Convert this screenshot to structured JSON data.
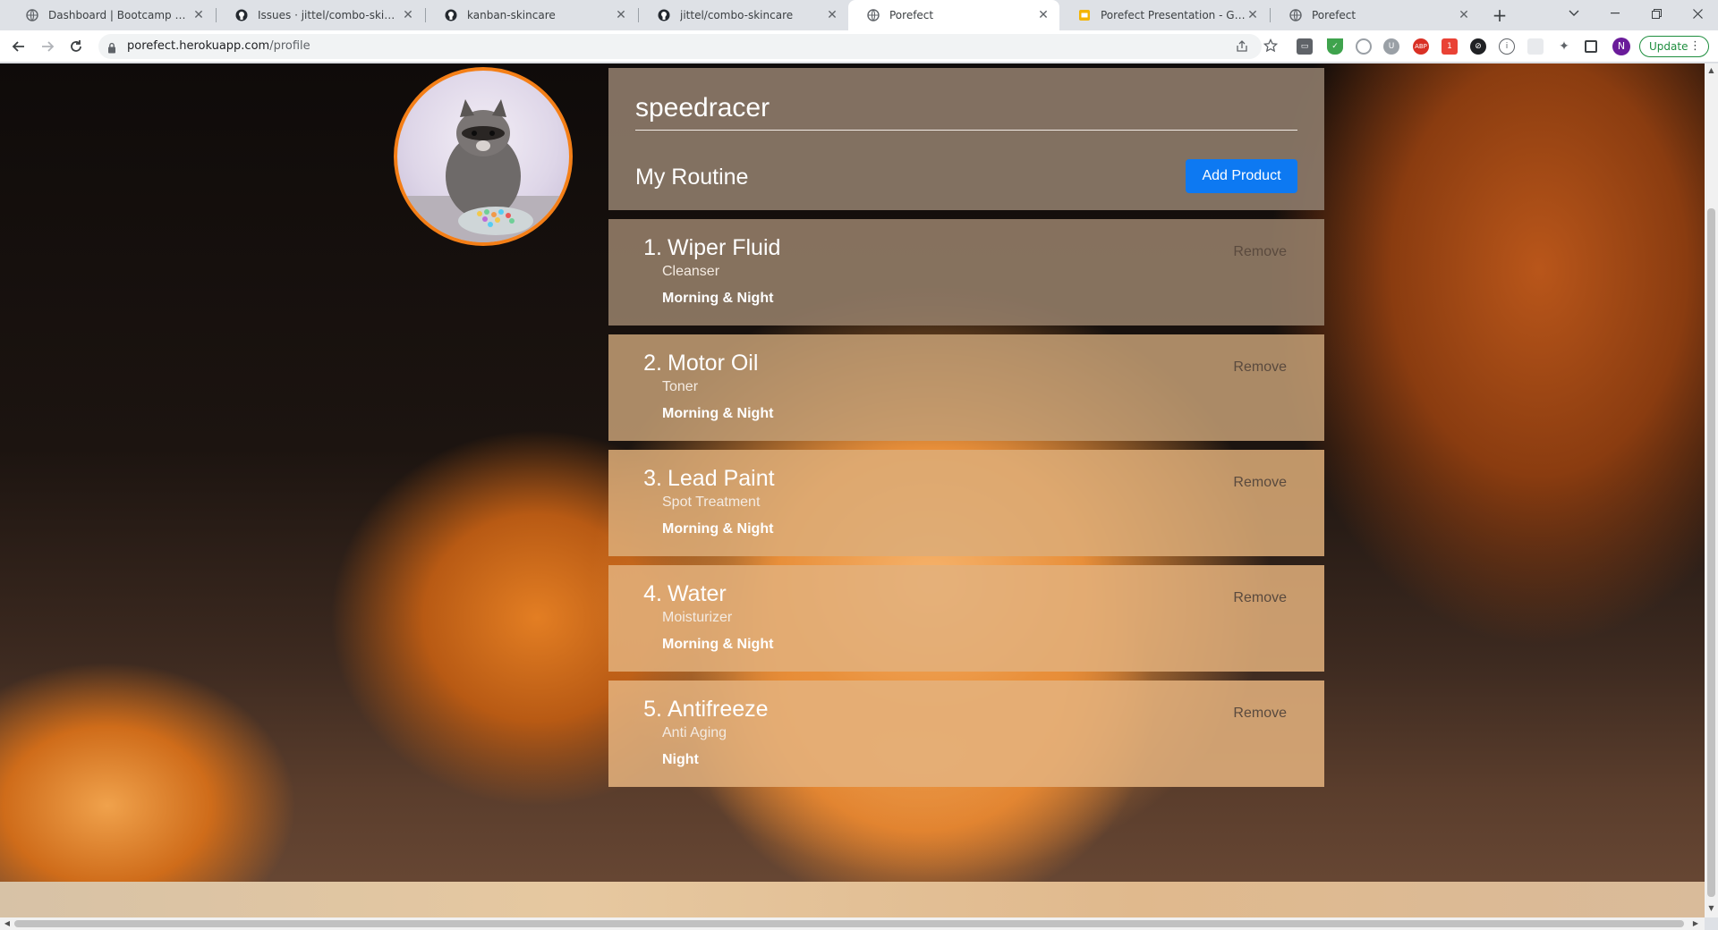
{
  "browser": {
    "tabs": [
      {
        "title": "Dashboard | Bootcamp Spot",
        "icon": "globe-icon"
      },
      {
        "title": "Issues · jittel/combo-skincare",
        "icon": "github-icon"
      },
      {
        "title": "kanban-skincare",
        "icon": "github-icon"
      },
      {
        "title": "jittel/combo-skincare",
        "icon": "github-icon"
      },
      {
        "title": "Porefect",
        "icon": "globe-icon",
        "active": true
      },
      {
        "title": "Porefect Presentation - Google S",
        "icon": "google-slides-icon"
      },
      {
        "title": "Porefect",
        "icon": "globe-icon"
      }
    ],
    "address": {
      "domain": "porefect.herokuapp.com",
      "path": "/profile"
    },
    "profile_initial": "N",
    "update_label": "Update"
  },
  "profile": {
    "username": "speedracer",
    "routine_title": "My Routine",
    "add_button": "Add Product"
  },
  "routine": [
    {
      "num": "1.",
      "name": "Wiper Fluid",
      "category": "Cleanser",
      "time": "Morning & Night",
      "remove": "Remove"
    },
    {
      "num": "2.",
      "name": "Motor Oil",
      "category": "Toner",
      "time": "Morning & Night",
      "remove": "Remove"
    },
    {
      "num": "3.",
      "name": "Lead Paint",
      "category": "Spot Treatment",
      "time": "Morning & Night",
      "remove": "Remove"
    },
    {
      "num": "4.",
      "name": "Water",
      "category": "Moisturizer",
      "time": "Morning & Night",
      "remove": "Remove"
    },
    {
      "num": "5.",
      "name": "Antifreeze",
      "category": "Anti Aging",
      "time": "Night",
      "remove": "Remove"
    }
  ],
  "colors": {
    "accent_button": "#0d79f2",
    "avatar_ring": "#f47f17"
  }
}
